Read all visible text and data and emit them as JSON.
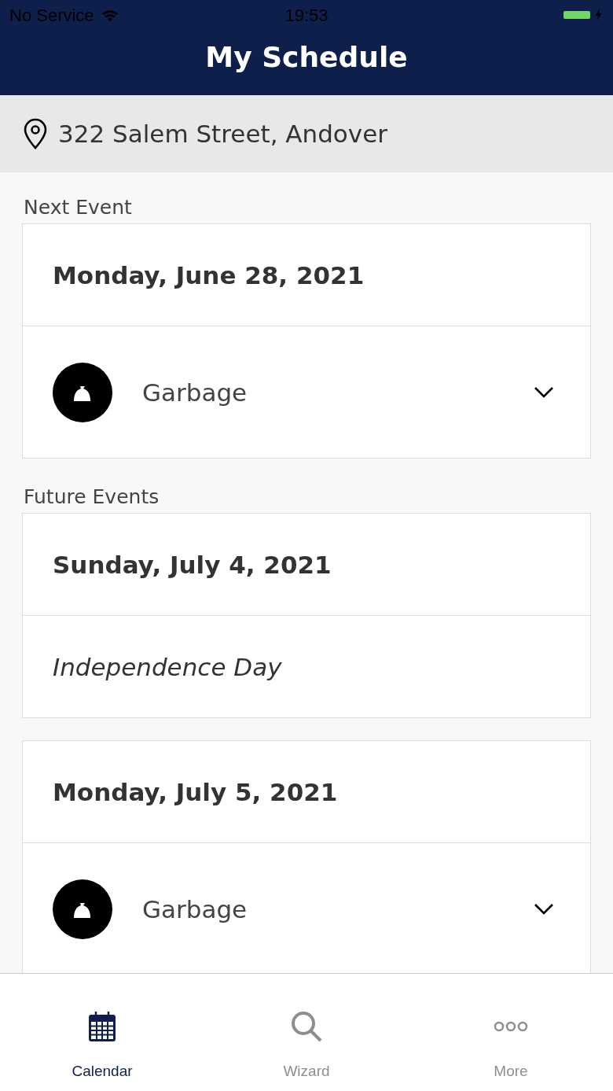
{
  "status_bar": {
    "carrier": "No Service",
    "time": "19:53"
  },
  "title": "My Schedule",
  "address": "322 Salem Street, Andover",
  "sections": [
    {
      "heading": "Next Event",
      "events": [
        {
          "date": "Monday, June 28, 2021",
          "items": [
            {
              "kind": "pickup",
              "label": "Garbage",
              "expanded": false
            }
          ]
        }
      ]
    },
    {
      "heading": "Future Events",
      "events": [
        {
          "date": "Sunday, July 4, 2021",
          "items": [
            {
              "kind": "holiday",
              "label": "Independence Day"
            }
          ]
        },
        {
          "date": "Monday, July 5, 2021",
          "items": [
            {
              "kind": "pickup",
              "label": "Garbage",
              "expanded": false
            }
          ]
        }
      ]
    }
  ],
  "tabs": [
    {
      "label": "Calendar",
      "selected": true,
      "kind": "calendar"
    },
    {
      "label": "Wizard",
      "selected": false,
      "kind": "wizard"
    },
    {
      "label": "More",
      "selected": false,
      "kind": "more"
    }
  ]
}
